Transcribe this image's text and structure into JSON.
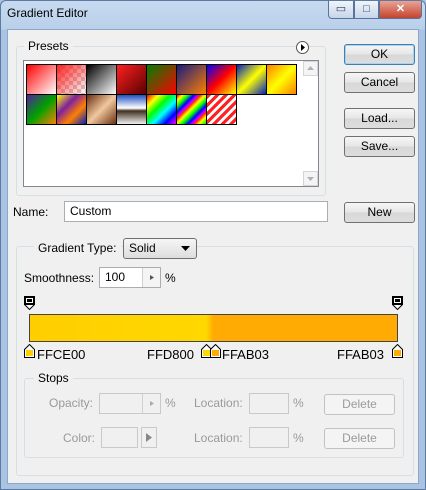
{
  "window": {
    "title": "Gradient Editor",
    "min_glyph": "▭",
    "max_glyph": "□",
    "close_glyph": "✕"
  },
  "buttons": {
    "ok": "OK",
    "cancel": "Cancel",
    "load": "Load...",
    "save": "Save...",
    "new": "New",
    "delete_opacity": "Delete",
    "delete_color": "Delete"
  },
  "presets": {
    "label": "Presets",
    "swatches": [
      {
        "name": "foreground-to-background",
        "css": "linear-gradient(135deg,#ff0000 0%,#ffffff 100%)"
      },
      {
        "name": "foreground-to-transparent",
        "css": "linear-gradient(135deg,#ff2020 0%,rgba(255,0,0,0) 100%)"
      },
      {
        "name": "black-white",
        "css": "linear-gradient(135deg,#000000 0%,#ffffff 100%)"
      },
      {
        "name": "red-dark",
        "css": "linear-gradient(135deg,#ff2020 0%,#5a0000 100%)"
      },
      {
        "name": "red-green",
        "css": "linear-gradient(135deg,#008000 0%,#ff0000 100%)"
      },
      {
        "name": "violet-orange",
        "css": "linear-gradient(135deg,#1a1a80 0%,#ff8000 100%)"
      },
      {
        "name": "blue-red-yellow",
        "css": "linear-gradient(135deg,#0000ff 0%,#ff0000 50%,#ffff00 100%)"
      },
      {
        "name": "blue-yellow-blue",
        "css": "linear-gradient(135deg,#0020c0 0%,#ffff00 50%,#0020c0 100%)"
      },
      {
        "name": "orange-yellow-orange",
        "css": "linear-gradient(135deg,#ff8000 0%,#ffff00 50%,#ff8000 100%)"
      },
      {
        "name": "violet-green-orange",
        "css": "linear-gradient(135deg,#5020a0 0%,#00a000 50%,#ff8000 100%)"
      },
      {
        "name": "yellow-violet-orange-blue",
        "css": "linear-gradient(135deg,#ffff00 0%,#8020a0 35%,#ff8000 65%,#0020c0 100%)"
      },
      {
        "name": "copper",
        "css": "linear-gradient(135deg,#6b2f0f 0%,#f0c8a0 50%,#6b2f0f 100%)"
      },
      {
        "name": "chrome",
        "css": "linear-gradient(180deg,#2050c0 0%,#ffffff 45%,#403020 55%,#f0f0f0 100%)"
      },
      {
        "name": "spectrum",
        "css": "linear-gradient(135deg,#ff0000,#ffff00,#00ff00,#00ffff,#0000ff,#ff00ff)"
      },
      {
        "name": "transparent-rainbow",
        "css": "repeating-linear-gradient(135deg,#ff0000 0,#ffff00 4px,#00ff00 8px,#0000ff 12px,#ff00ff 16px)"
      },
      {
        "name": "transparent-stripes",
        "css": "repeating-linear-gradient(135deg,#ff2020 0,#ff2020 3px,#ffffff 3px,#ffffff 6px)"
      }
    ]
  },
  "name": {
    "label": "Name:",
    "value": "Custom"
  },
  "gradient": {
    "type_label": "Gradient Type:",
    "type_value": "Solid",
    "smoothness_label": "Smoothness:",
    "smoothness_value": "100",
    "smoothness_unit": "%",
    "colors": [
      "#FFCE00",
      "#FFD800",
      "#FFAB03",
      "#FFAB03"
    ],
    "color_stops": [
      {
        "label": "FFCE00",
        "color": "#FFCE00",
        "location": 0
      },
      {
        "label": "FFD800",
        "color": "#FFD800",
        "location": 48
      },
      {
        "label": "FFAB03",
        "color": "#FFAB03",
        "location": 50
      },
      {
        "label": "FFAB03",
        "color": "#FFAB03",
        "location": 100
      }
    ],
    "opacity_stops": [
      {
        "location": 0
      },
      {
        "location": 100
      }
    ]
  },
  "stops": {
    "label": "Stops",
    "opacity_label": "Opacity:",
    "opacity_unit": "%",
    "location_label_1": "Location:",
    "location_unit_1": "%",
    "color_label": "Color:",
    "location_label_2": "Location:",
    "location_unit_2": "%"
  }
}
